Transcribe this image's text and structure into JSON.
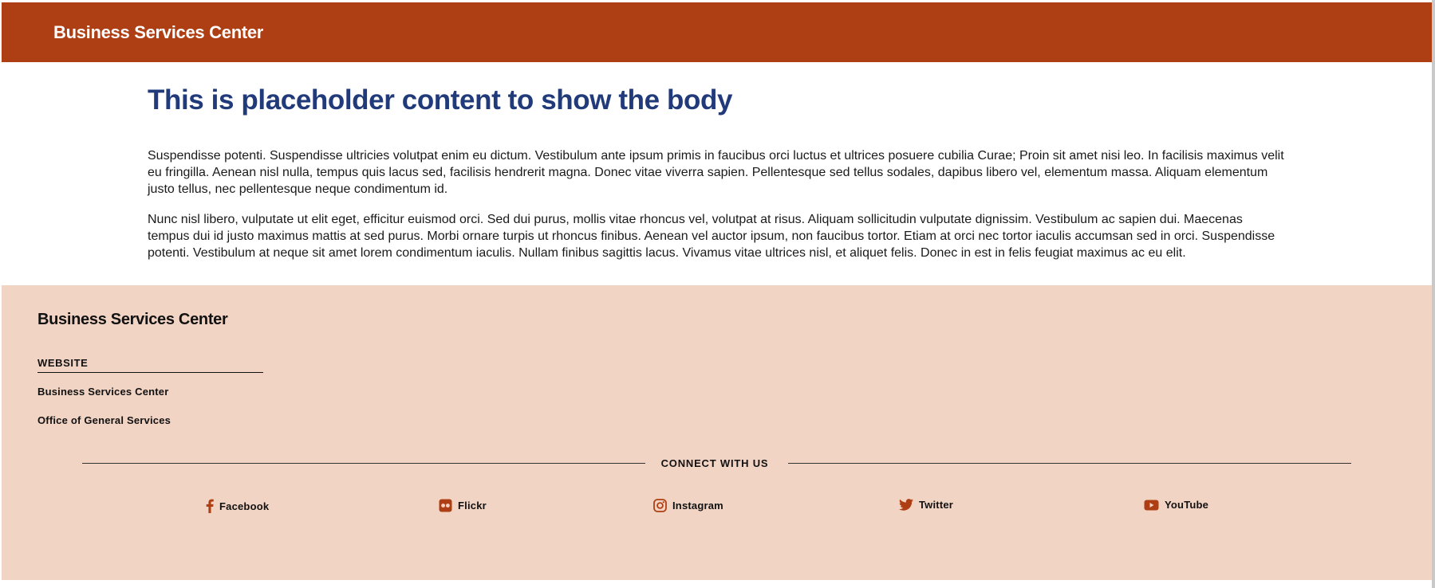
{
  "header": {
    "title": "Business Services Center"
  },
  "main": {
    "title": "This is placeholder content to show the body",
    "paragraphs": [
      "Suspendisse potenti. Suspendisse ultricies volutpat enim eu dictum. Vestibulum ante ipsum primis in faucibus orci luctus et ultrices posuere cubilia Curae; Proin sit amet nisi leo. In facilisis maximus velit eu fringilla. Aenean nisl nulla, tempus quis lacus sed, facilisis hendrerit magna. Donec vitae viverra sapien. Pellentesque sed tellus sodales, dapibus libero vel, elementum massa. Aliquam elementum justo tellus, nec pellentesque neque condimentum id.",
      "Nunc nisl libero, vulputate ut elit eget, efficitur euismod orci. Sed dui purus, mollis vitae rhoncus vel, volutpat at risus. Aliquam sollicitudin vulputate dignissim. Vestibulum ac sapien dui. Maecenas tempus dui id justo maximus mattis at sed purus. Morbi ornare turpis ut rhoncus finibus. Aenean vel auctor ipsum, non faucibus tortor. Etiam at orci nec tortor iaculis accumsan sed in orci. Suspendisse potenti. Vestibulum at neque sit amet lorem condimentum iaculis. Nullam finibus sagittis lacus. Vivamus vitae ultrices nisl, et aliquet felis. Donec in est in felis feugiat maximus ac eu elit."
    ]
  },
  "footer": {
    "title": "Business Services Center",
    "website_heading": "WEBSITE",
    "links": [
      "Business Services Center",
      "Office of General Services"
    ],
    "connect_label": "CONNECT WITH US",
    "social": [
      {
        "label": "Facebook",
        "icon": "facebook-icon"
      },
      {
        "label": "Flickr",
        "icon": "flickr-icon"
      },
      {
        "label": "Instagram",
        "icon": "instagram-icon"
      },
      {
        "label": "Twitter",
        "icon": "twitter-icon"
      },
      {
        "label": "YouTube",
        "icon": "youtube-icon"
      }
    ]
  },
  "colors": {
    "header_bg": "#ae3f14",
    "title_blue": "#213a7a",
    "footer_bg": "#f2d4c5",
    "icon_accent": "#ae3f14"
  }
}
